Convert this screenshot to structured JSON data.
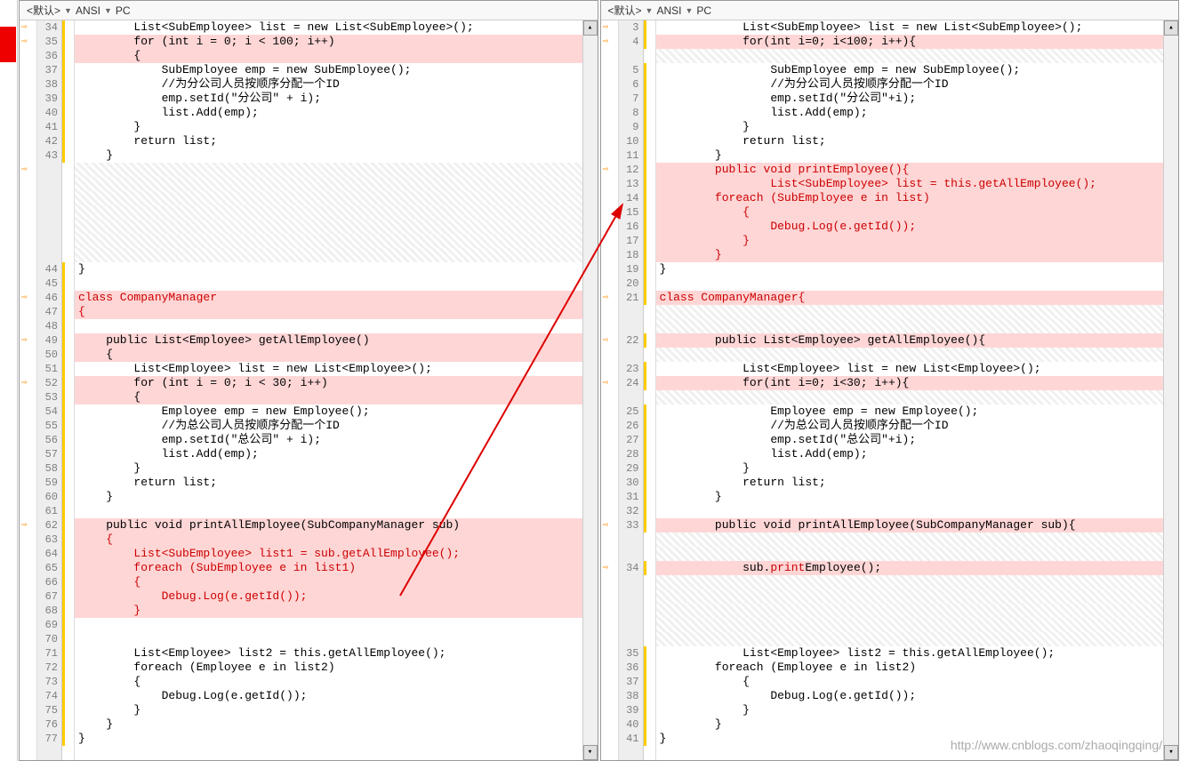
{
  "toolbar": {
    "default": "<默认>",
    "ansi": "ANSI",
    "pc": "PC"
  },
  "watermark": "http://www.cnblogs.com/zhaoqingqing/",
  "left": {
    "start": 34,
    "lines": [
      {
        "n": 34,
        "t": "        List<SubEmployee> list = new List<SubEmployee>();",
        "cls": "",
        "arr": true
      },
      {
        "n": 35,
        "t": "        for (int i = 0; i < 100; i++)",
        "cls": "hl-red",
        "arr": true
      },
      {
        "n": 36,
        "t": "        {",
        "cls": "hl-red"
      },
      {
        "n": 37,
        "t": "            SubEmployee emp = new SubEmployee();",
        "cls": ""
      },
      {
        "n": 38,
        "t": "            //为分公司人员按顺序分配一个ID",
        "cls": ""
      },
      {
        "n": 39,
        "t": "            emp.setId(\"分公司\" + i);",
        "cls": ""
      },
      {
        "n": 40,
        "t": "            list.Add(emp);",
        "cls": ""
      },
      {
        "n": 41,
        "t": "        }",
        "cls": ""
      },
      {
        "n": 42,
        "t": "        return list;",
        "cls": ""
      },
      {
        "n": 43,
        "t": "    }",
        "cls": ""
      },
      {
        "n": "",
        "t": "",
        "cls": "hl-hatch",
        "arr": true
      },
      {
        "n": "",
        "t": "",
        "cls": "hl-hatch"
      },
      {
        "n": "",
        "t": "",
        "cls": "hl-hatch"
      },
      {
        "n": "",
        "t": "",
        "cls": "hl-hatch"
      },
      {
        "n": "",
        "t": "",
        "cls": "hl-hatch"
      },
      {
        "n": "",
        "t": "",
        "cls": "hl-hatch"
      },
      {
        "n": "",
        "t": "",
        "cls": "hl-hatch"
      },
      {
        "n": 44,
        "t": "}",
        "cls": ""
      },
      {
        "n": 45,
        "t": "",
        "cls": ""
      },
      {
        "n": 46,
        "t": "class CompanyManager",
        "cls": "hl-red txt-red",
        "arr": true
      },
      {
        "n": 47,
        "t": "{",
        "cls": "hl-red txt-red"
      },
      {
        "n": 48,
        "t": "",
        "cls": ""
      },
      {
        "n": 49,
        "t": "    public List<Employee> getAllEmployee()",
        "cls": "hl-red",
        "arr": true
      },
      {
        "n": 50,
        "t": "    {",
        "cls": "hl-red"
      },
      {
        "n": 51,
        "t": "        List<Employee> list = new List<Employee>();",
        "cls": ""
      },
      {
        "n": 52,
        "t": "        for (int i = 0; i < 30; i++)",
        "cls": "hl-red",
        "arr": true
      },
      {
        "n": 53,
        "t": "        {",
        "cls": "hl-red"
      },
      {
        "n": 54,
        "t": "            Employee emp = new Employee();",
        "cls": ""
      },
      {
        "n": 55,
        "t": "            //为总公司人员按顺序分配一个ID",
        "cls": ""
      },
      {
        "n": 56,
        "t": "            emp.setId(\"总公司\" + i);",
        "cls": ""
      },
      {
        "n": 57,
        "t": "            list.Add(emp);",
        "cls": ""
      },
      {
        "n": 58,
        "t": "        }",
        "cls": ""
      },
      {
        "n": 59,
        "t": "        return list;",
        "cls": ""
      },
      {
        "n": 60,
        "t": "    }",
        "cls": ""
      },
      {
        "n": 61,
        "t": "",
        "cls": ""
      },
      {
        "n": 62,
        "t": "    public void printAllEmployee(SubCompanyManager sub)",
        "cls": "hl-red",
        "arr": true
      },
      {
        "n": 63,
        "t": "    {",
        "cls": "hl-red txt-red"
      },
      {
        "n": 64,
        "t": "        List<SubEmployee> list1 = sub.getAllEmployee();",
        "cls": "hl-red txt-red"
      },
      {
        "n": 65,
        "t": "        foreach (SubEmployee e in list1)",
        "cls": "hl-red txt-red"
      },
      {
        "n": 66,
        "t": "        {",
        "cls": "hl-red txt-red"
      },
      {
        "n": 67,
        "t": "            Debug.Log(e.getId());",
        "cls": "hl-red txt-red"
      },
      {
        "n": 68,
        "t": "        }",
        "cls": "hl-red txt-red"
      },
      {
        "n": 69,
        "t": "",
        "cls": ""
      },
      {
        "n": 70,
        "t": "",
        "cls": ""
      },
      {
        "n": 71,
        "t": "        List<Employee> list2 = this.getAllEmployee();",
        "cls": ""
      },
      {
        "n": 72,
        "t": "        foreach (Employee e in list2)",
        "cls": ""
      },
      {
        "n": 73,
        "t": "        {",
        "cls": ""
      },
      {
        "n": 74,
        "t": "            Debug.Log(e.getId());",
        "cls": ""
      },
      {
        "n": 75,
        "t": "        }",
        "cls": ""
      },
      {
        "n": 76,
        "t": "    }",
        "cls": ""
      },
      {
        "n": 77,
        "t": "}",
        "cls": ""
      }
    ]
  },
  "right": {
    "lines": [
      {
        "n": 3,
        "t": "            List<SubEmployee> list = new List<SubEmployee>();",
        "cls": "",
        "arr": true
      },
      {
        "n": 4,
        "t": "            for(int i=0; i<100; i++){",
        "cls": "hl-red",
        "arr": true
      },
      {
        "n": "",
        "t": "",
        "cls": "hl-hatch"
      },
      {
        "n": 5,
        "t": "                SubEmployee emp = new SubEmployee();",
        "cls": ""
      },
      {
        "n": 6,
        "t": "                //为分公司人员按顺序分配一个ID",
        "cls": ""
      },
      {
        "n": 7,
        "t": "                emp.setId(\"分公司\"+i);",
        "cls": ""
      },
      {
        "n": 8,
        "t": "                list.Add(emp);",
        "cls": ""
      },
      {
        "n": 9,
        "t": "            }",
        "cls": ""
      },
      {
        "n": 10,
        "t": "            return list;",
        "cls": ""
      },
      {
        "n": 11,
        "t": "        }",
        "cls": ""
      },
      {
        "n": 12,
        "t": "        public void printEmployee(){",
        "cls": "hl-red txt-red",
        "arr": true
      },
      {
        "n": 13,
        "t": "                List<SubEmployee> list = this.getAllEmployee();",
        "cls": "hl-red txt-red"
      },
      {
        "n": 14,
        "t": "        foreach (SubEmployee e in list)",
        "cls": "hl-red txt-red"
      },
      {
        "n": 15,
        "t": "            {",
        "cls": "hl-red txt-red"
      },
      {
        "n": 16,
        "t": "                Debug.Log(e.getId());",
        "cls": "hl-red txt-red"
      },
      {
        "n": 17,
        "t": "            }",
        "cls": "hl-red txt-red"
      },
      {
        "n": 18,
        "t": "        }",
        "cls": "hl-red txt-red"
      },
      {
        "n": 19,
        "t": "}",
        "cls": ""
      },
      {
        "n": 20,
        "t": "",
        "cls": ""
      },
      {
        "n": 21,
        "t": "class CompanyManager{",
        "cls": "hl-red txt-red",
        "arr": true
      },
      {
        "n": "",
        "t": "",
        "cls": "hl-hatch"
      },
      {
        "n": "",
        "t": "",
        "cls": "hl-hatch"
      },
      {
        "n": 22,
        "t": "        public List<Employee> getAllEmployee(){",
        "cls": "hl-red",
        "arr": true
      },
      {
        "n": "",
        "t": "",
        "cls": "hl-hatch"
      },
      {
        "n": 23,
        "t": "            List<Employee> list = new List<Employee>();",
        "cls": ""
      },
      {
        "n": 24,
        "t": "            for(int i=0; i<30; i++){",
        "cls": "hl-red",
        "arr": true
      },
      {
        "n": "",
        "t": "",
        "cls": "hl-hatch"
      },
      {
        "n": 25,
        "t": "                Employee emp = new Employee();",
        "cls": ""
      },
      {
        "n": 26,
        "t": "                //为总公司人员按顺序分配一个ID",
        "cls": ""
      },
      {
        "n": 27,
        "t": "                emp.setId(\"总公司\"+i);",
        "cls": ""
      },
      {
        "n": 28,
        "t": "                list.Add(emp);",
        "cls": ""
      },
      {
        "n": 29,
        "t": "            }",
        "cls": ""
      },
      {
        "n": 30,
        "t": "            return list;",
        "cls": ""
      },
      {
        "n": 31,
        "t": "        }",
        "cls": ""
      },
      {
        "n": 32,
        "t": "",
        "cls": ""
      },
      {
        "n": 33,
        "t": "        public void printAllEmployee(SubCompanyManager sub){",
        "cls": "hl-red",
        "arr": true
      },
      {
        "n": "",
        "t": "",
        "cls": "hl-hatch"
      },
      {
        "n": "",
        "t": "",
        "cls": "hl-hatch"
      },
      {
        "n": 34,
        "t": "            sub.printEmployee();",
        "cls": "hl-red",
        "arr": true,
        "rich": "            sub.<r>print</r>Employee();"
      },
      {
        "n": "",
        "t": "",
        "cls": "hl-hatch"
      },
      {
        "n": "",
        "t": "",
        "cls": "hl-hatch"
      },
      {
        "n": "",
        "t": "",
        "cls": "hl-hatch"
      },
      {
        "n": "",
        "t": "",
        "cls": "hl-hatch"
      },
      {
        "n": "",
        "t": "",
        "cls": "hl-hatch"
      },
      {
        "n": 35,
        "t": "            List<Employee> list2 = this.getAllEmployee();",
        "cls": ""
      },
      {
        "n": 36,
        "t": "        foreach (Employee e in list2)",
        "cls": ""
      },
      {
        "n": 37,
        "t": "            {",
        "cls": ""
      },
      {
        "n": 38,
        "t": "                Debug.Log(e.getId());",
        "cls": ""
      },
      {
        "n": 39,
        "t": "            }",
        "cls": ""
      },
      {
        "n": 40,
        "t": "        }",
        "cls": ""
      },
      {
        "n": 41,
        "t": "}",
        "cls": ""
      }
    ]
  }
}
